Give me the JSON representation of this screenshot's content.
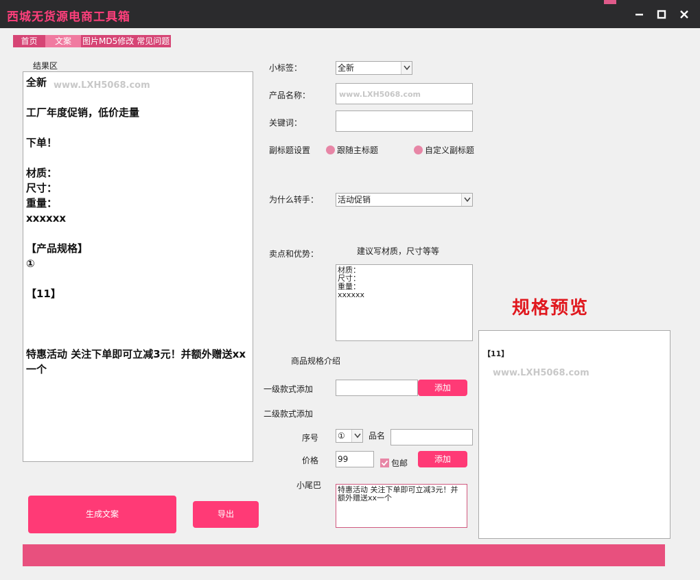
{
  "window": {
    "title": "西城无货源电商工具箱"
  },
  "tabs": [
    {
      "label": "首页"
    },
    {
      "label": "文案"
    },
    {
      "label": "图片MD5修改"
    },
    {
      "label": "常见问题"
    }
  ],
  "result": {
    "label": "结果区",
    "lines": [
      "全新",
      "",
      "工厂年度促销，低价走量",
      "",
      "下单！",
      "",
      "材质：",
      "尺寸：",
      "重量：",
      "xxxxxx",
      "",
      "【产品规格】",
      "①",
      "",
      "【11】",
      "",
      "",
      "",
      ""
    ],
    "tail": "特惠活动 关注下单即可立减3元！并额外赠送xx一个",
    "watermark": "www.LXH5068.com"
  },
  "form": {
    "tag_label": "小标签：",
    "tag_value": "全新",
    "name_label": "产品名称：",
    "name_placeholder": "www.LXH5068.com",
    "keyword_label": "关键词：",
    "subtitle_label": "副标题设置",
    "radio_follow": "跟随主标题",
    "radio_custom": "自定义副标题",
    "reason_label": "为什么转手：",
    "reason_value": "活动促销",
    "selling_label": "卖点和优势：",
    "selling_hint": "建议写材质，尺寸等等",
    "selling_text": "材质：\n尺寸：\n重量：\nxxxxxx",
    "spec_intro": "商品规格介绍",
    "level1_label": "一级款式添加",
    "add_label": "添加",
    "level2_label": "二级款式添加",
    "seq_label": "序号",
    "seq_value": "①",
    "item_name_label": "品名",
    "price_label": "价格",
    "price_value": "99",
    "shipping_label": "包邮",
    "tail_label": "小尾巴",
    "tail_text": "特惠活动 关注下单即可立减3元！并额外赠送xx一个"
  },
  "buttons": {
    "generate": "生成文案",
    "export": "导出"
  },
  "preview": {
    "title": "规格预览",
    "content": "【11】",
    "watermark": "www.LXH5068.com"
  },
  "colors": {
    "accent": "#ff3a76",
    "title_text": "#ff3f7c",
    "preview_title": "#e0181e",
    "bar": "#e8507e"
  }
}
